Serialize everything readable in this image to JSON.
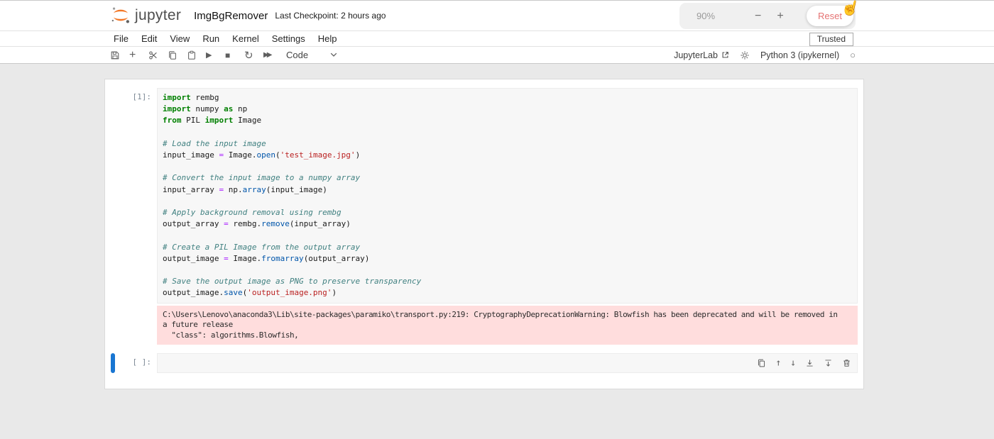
{
  "header": {
    "logo_text": "jupyter",
    "notebook_title": "ImgBgRemover",
    "checkpoint": "Last Checkpoint: 2 hours ago",
    "zoom": {
      "level": "90%",
      "minus": "−",
      "plus": "+",
      "reset_label": "Reset"
    }
  },
  "menubar": {
    "items": [
      "File",
      "Edit",
      "View",
      "Run",
      "Kernel",
      "Settings",
      "Help"
    ],
    "trusted_label": "Trusted"
  },
  "toolbar": {
    "cell_type_label": "Code",
    "jupyterlab_label": "JupyterLab",
    "kernel_label": "Python 3 (ipykernel)"
  },
  "icons": {
    "add": "+",
    "run": "▶",
    "stop": "■",
    "restart": "↻",
    "run_all": "▶▶",
    "kernel_status": "○",
    "move_up": "↑",
    "move_down": "↓",
    "pointer_hand": "☝"
  },
  "colors": {
    "accent_blue": "#1976d2",
    "jupyter_orange": "#f37726",
    "warning_bg": "#ffdddd",
    "keyword_green": "#008000",
    "string_red": "#BA2121",
    "comment_teal": "#408080"
  },
  "notebook": {
    "cells": [
      {
        "prompt": "[1]:",
        "source": [
          [
            {
              "t": "kw",
              "v": "import"
            },
            {
              "t": "tx",
              "v": " rembg"
            }
          ],
          [
            {
              "t": "kw",
              "v": "import"
            },
            {
              "t": "tx",
              "v": " numpy "
            },
            {
              "t": "kw",
              "v": "as"
            },
            {
              "t": "tx",
              "v": " np"
            }
          ],
          [
            {
              "t": "kw",
              "v": "from"
            },
            {
              "t": "tx",
              "v": " PIL "
            },
            {
              "t": "kw",
              "v": "import"
            },
            {
              "t": "tx",
              "v": " Image"
            }
          ],
          [],
          [
            {
              "t": "cm",
              "v": "# Load the input image"
            }
          ],
          [
            {
              "t": "tx",
              "v": "input_image "
            },
            {
              "t": "op",
              "v": "="
            },
            {
              "t": "tx",
              "v": " Image."
            },
            {
              "t": "fn",
              "v": "open"
            },
            {
              "t": "tx",
              "v": "("
            },
            {
              "t": "st",
              "v": "'test_image.jpg'"
            },
            {
              "t": "tx",
              "v": ")"
            }
          ],
          [],
          [
            {
              "t": "cm",
              "v": "# Convert the input image to a numpy array"
            }
          ],
          [
            {
              "t": "tx",
              "v": "input_array "
            },
            {
              "t": "op",
              "v": "="
            },
            {
              "t": "tx",
              "v": " np."
            },
            {
              "t": "fn",
              "v": "array"
            },
            {
              "t": "tx",
              "v": "(input_image)"
            }
          ],
          [],
          [
            {
              "t": "cm",
              "v": "# Apply background removal using rembg"
            }
          ],
          [
            {
              "t": "tx",
              "v": "output_array "
            },
            {
              "t": "op",
              "v": "="
            },
            {
              "t": "tx",
              "v": " rembg."
            },
            {
              "t": "fn",
              "v": "remove"
            },
            {
              "t": "tx",
              "v": "(input_array)"
            }
          ],
          [],
          [
            {
              "t": "cm",
              "v": "# Create a PIL Image from the output array"
            }
          ],
          [
            {
              "t": "tx",
              "v": "output_image "
            },
            {
              "t": "op",
              "v": "="
            },
            {
              "t": "tx",
              "v": " Image."
            },
            {
              "t": "fn",
              "v": "fromarray"
            },
            {
              "t": "tx",
              "v": "(output_array)"
            }
          ],
          [],
          [
            {
              "t": "cm",
              "v": "# Save the output image as PNG to preserve transparency"
            }
          ],
          [
            {
              "t": "tx",
              "v": "output_image."
            },
            {
              "t": "fn",
              "v": "save"
            },
            {
              "t": "tx",
              "v": "("
            },
            {
              "t": "st",
              "v": "'output_image.png'"
            },
            {
              "t": "tx",
              "v": ")"
            }
          ]
        ],
        "output_text": "C:\\Users\\Lenovo\\anaconda3\\Lib\\site-packages\\paramiko\\transport.py:219: CryptographyDeprecationWarning: Blowfish has been deprecated and will be removed in\na future release\n  \"class\": algorithms.Blowfish,"
      },
      {
        "prompt": "[ ]:",
        "source": []
      }
    ]
  }
}
